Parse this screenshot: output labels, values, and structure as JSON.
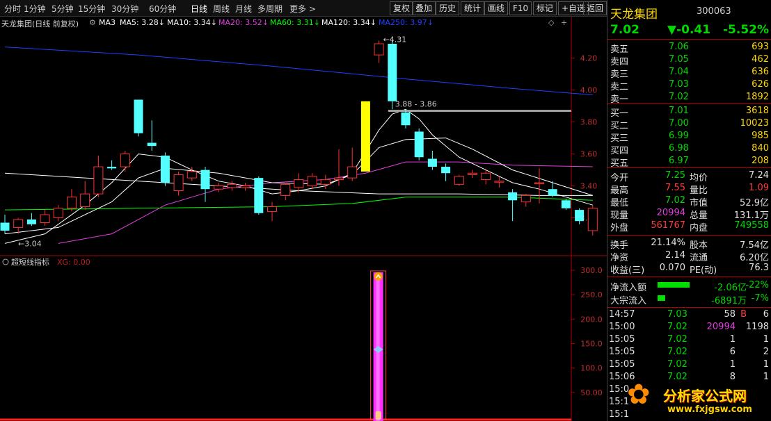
{
  "toolbar": {
    "periods": [
      "分时",
      "1分钟",
      "5分钟",
      "15分钟",
      "30分钟",
      "60分钟",
      "日线",
      "周线",
      "月线",
      "多周期",
      "更多 >"
    ],
    "buttons": [
      "复权",
      "叠加",
      "历史",
      "统计",
      "画线",
      "F10",
      "标记",
      "+自选",
      "返回"
    ]
  },
  "kline": {
    "title": "天龙集团(日线 前复权)",
    "ma": [
      {
        "label": "MA3",
        "color": "#ffffff"
      },
      {
        "label": "MA5: 3.28↓",
        "color": "#ffffff"
      },
      {
        "label": "MA10: 3.34↓",
        "color": "#ffffff"
      },
      {
        "label": "MA20: 3.52↓",
        "color": "#e040e0"
      },
      {
        "label": "MA60: 3.31↓",
        "color": "#00ff00"
      },
      {
        "label": "MA120: 3.34↓",
        "color": "#ffffff"
      },
      {
        "label": "MA250: 3.97↓",
        "color": "#2040ff"
      }
    ],
    "high_label": "4.31",
    "low_label": "3.04",
    "level_label": "3.88 - 3.86",
    "y_ticks": [
      "4.20",
      "4.00",
      "3.80",
      "3.60",
      "3.40",
      "3.20"
    ]
  },
  "indicator": {
    "title": "超短线指标",
    "xg_label": "XG: 0.00",
    "y_ticks": [
      "300.0",
      "250.0",
      "200.0",
      "150.0",
      "100.0",
      "50.00"
    ]
  },
  "chart_data": {
    "type": "candlestick",
    "ylim": [
      3.02,
      4.39
    ],
    "candles": [
      {
        "o": 3.17,
        "c": 3.12,
        "h": 3.22,
        "l": 3.1
      },
      {
        "o": 3.14,
        "c": 3.19,
        "h": 3.2,
        "l": 3.1
      },
      {
        "o": 3.19,
        "c": 3.16,
        "h": 3.23,
        "l": 3.15
      },
      {
        "o": 3.17,
        "c": 3.22,
        "h": 3.25,
        "l": 3.15
      },
      {
        "o": 3.2,
        "c": 3.26,
        "h": 3.28,
        "l": 3.18
      },
      {
        "o": 3.26,
        "c": 3.33,
        "h": 3.38,
        "l": 3.24
      },
      {
        "o": 3.27,
        "c": 3.35,
        "h": 3.43,
        "l": 3.25
      },
      {
        "o": 3.35,
        "c": 3.52,
        "h": 3.59,
        "l": 3.33
      },
      {
        "o": 3.52,
        "c": 3.51,
        "h": 3.56,
        "l": 3.5
      },
      {
        "o": 3.52,
        "c": 3.6,
        "h": 3.62,
        "l": 3.49
      },
      {
        "o": 3.94,
        "c": 3.73,
        "h": 3.94,
        "l": 3.71
      },
      {
        "o": 3.67,
        "c": 3.65,
        "h": 3.81,
        "l": 3.62
      },
      {
        "o": 3.59,
        "c": 3.42,
        "h": 3.61,
        "l": 3.4
      },
      {
        "o": 3.37,
        "c": 3.47,
        "h": 3.49,
        "l": 3.34
      },
      {
        "o": 3.45,
        "c": 3.49,
        "h": 3.52,
        "l": 3.43
      },
      {
        "o": 3.5,
        "c": 3.38,
        "h": 3.52,
        "l": 3.3
      },
      {
        "o": 3.38,
        "c": 3.4,
        "h": 3.42,
        "l": 3.36
      },
      {
        "o": 3.39,
        "c": 3.41,
        "h": 3.43,
        "l": 3.37
      },
      {
        "o": 3.39,
        "c": 3.4,
        "h": 3.42,
        "l": 3.37
      },
      {
        "o": 3.45,
        "c": 3.23,
        "h": 3.46,
        "l": 3.22
      },
      {
        "o": 3.24,
        "c": 3.27,
        "h": 3.3,
        "l": 3.18
      },
      {
        "o": 3.34,
        "c": 3.41,
        "h": 3.42,
        "l": 3.31
      },
      {
        "o": 3.39,
        "c": 3.44,
        "h": 3.48,
        "l": 3.36
      },
      {
        "o": 3.4,
        "c": 3.46,
        "h": 3.48,
        "l": 3.38
      },
      {
        "o": 3.41,
        "c": 3.44,
        "h": 3.47,
        "l": 3.38
      },
      {
        "o": 3.44,
        "c": 3.45,
        "h": 3.63,
        "l": 3.4
      },
      {
        "o": 3.45,
        "c": 3.52,
        "h": 3.64,
        "l": 3.43
      },
      {
        "o": 3.49,
        "c": 3.93,
        "h": 3.93,
        "l": 3.49
      },
      {
        "o": 4.22,
        "c": 4.29,
        "h": 4.31,
        "l": 4.17
      },
      {
        "o": 4.29,
        "c": 3.93,
        "h": 4.31,
        "l": 3.88
      },
      {
        "o": 3.86,
        "c": 3.78,
        "h": 3.88,
        "l": 3.76
      },
      {
        "o": 3.74,
        "c": 3.58,
        "h": 3.76,
        "l": 3.56
      },
      {
        "o": 3.57,
        "c": 3.52,
        "h": 3.62,
        "l": 3.5
      },
      {
        "o": 3.52,
        "c": 3.48,
        "h": 3.54,
        "l": 3.43
      },
      {
        "o": 3.41,
        "c": 3.46,
        "h": 3.47,
        "l": 3.4
      },
      {
        "o": 3.47,
        "c": 3.48,
        "h": 3.5,
        "l": 3.45
      },
      {
        "o": 3.44,
        "c": 3.48,
        "h": 3.5,
        "l": 3.41
      },
      {
        "o": 3.43,
        "c": 3.43,
        "h": 3.46,
        "l": 3.39
      },
      {
        "o": 3.36,
        "c": 3.31,
        "h": 3.38,
        "l": 3.18
      },
      {
        "o": 3.3,
        "c": 3.34,
        "h": 3.35,
        "l": 3.27
      },
      {
        "o": 3.42,
        "c": 3.42,
        "h": 3.51,
        "l": 3.29
      },
      {
        "o": 3.38,
        "c": 3.34,
        "h": 3.43,
        "l": 3.33
      },
      {
        "o": 3.31,
        "c": 3.26,
        "h": 3.32,
        "l": 3.25
      },
      {
        "o": 3.25,
        "c": 3.18,
        "h": 3.26,
        "l": 3.16
      },
      {
        "o": 3.12,
        "c": 3.26,
        "h": 3.28,
        "l": 3.09
      }
    ],
    "ma_lines": [
      {
        "name": "MA250",
        "color": "#2040ff",
        "values": [
          [
            0,
            4.27
          ],
          [
            10,
            4.22
          ],
          [
            20,
            4.15
          ],
          [
            30,
            4.07
          ],
          [
            38,
            4.01
          ],
          [
            44,
            3.97
          ]
        ]
      },
      {
        "name": "MA60",
        "color": "#00ff00",
        "values": [
          [
            0,
            3.25
          ],
          [
            10,
            3.26
          ],
          [
            20,
            3.27
          ],
          [
            26,
            3.29
          ],
          [
            30,
            3.33
          ],
          [
            38,
            3.33
          ],
          [
            44,
            3.31
          ]
        ]
      },
      {
        "name": "MA120",
        "color": "#ffffff",
        "values": [
          [
            0,
            3.48
          ],
          [
            8,
            3.44
          ],
          [
            16,
            3.4
          ],
          [
            22,
            3.37
          ],
          [
            28,
            3.35
          ],
          [
            34,
            3.35
          ],
          [
            40,
            3.34
          ],
          [
            44,
            3.34
          ]
        ]
      },
      {
        "name": "MA20",
        "color": "#e040e0",
        "values": [
          [
            4,
            3.04
          ],
          [
            8,
            3.1
          ],
          [
            12,
            3.28
          ],
          [
            16,
            3.38
          ],
          [
            20,
            3.42
          ],
          [
            24,
            3.44
          ],
          [
            27,
            3.48
          ],
          [
            30,
            3.55
          ],
          [
            34,
            3.55
          ],
          [
            38,
            3.53
          ],
          [
            44,
            3.52
          ]
        ]
      },
      {
        "name": "MA10",
        "color": "#ffffff",
        "values": [
          [
            0,
            3.1
          ],
          [
            4,
            3.14
          ],
          [
            8,
            3.3
          ],
          [
            10,
            3.45
          ],
          [
            12,
            3.51
          ],
          [
            16,
            3.48
          ],
          [
            20,
            3.42
          ],
          [
            24,
            3.41
          ],
          [
            26,
            3.47
          ],
          [
            28,
            3.64
          ],
          [
            30,
            3.69
          ],
          [
            33,
            3.7
          ],
          [
            35,
            3.63
          ],
          [
            38,
            3.5
          ],
          [
            41,
            3.42
          ],
          [
            44,
            3.34
          ]
        ]
      },
      {
        "name": "MA5",
        "color": "#ffffff",
        "values": [
          [
            0,
            3.04
          ],
          [
            3,
            3.1
          ],
          [
            6,
            3.28
          ],
          [
            8,
            3.42
          ],
          [
            10,
            3.6
          ],
          [
            12,
            3.58
          ],
          [
            14,
            3.5
          ],
          [
            16,
            3.43
          ],
          [
            18,
            3.4
          ],
          [
            20,
            3.35
          ],
          [
            22,
            3.37
          ],
          [
            24,
            3.4
          ],
          [
            26,
            3.48
          ],
          [
            28,
            3.75
          ],
          [
            29,
            3.85
          ],
          [
            30,
            3.88
          ],
          [
            31,
            3.82
          ],
          [
            32,
            3.72
          ],
          [
            34,
            3.58
          ],
          [
            36,
            3.5
          ],
          [
            38,
            3.42
          ],
          [
            40,
            3.38
          ],
          [
            42,
            3.33
          ],
          [
            44,
            3.28
          ]
        ]
      }
    ],
    "resistance": {
      "from": 29,
      "value": 3.87
    },
    "indicator": {
      "type": "bar",
      "ylim": [
        0,
        330
      ],
      "bar_index": 28,
      "value": 296,
      "marker_value": 138
    }
  },
  "quote": {
    "name": "天龙集团",
    "code": "300063",
    "price": "7.02",
    "change": "▼-0.41",
    "pct": "-5.52%",
    "asks": [
      {
        "label": "卖五",
        "price": "7.06",
        "vol": "693"
      },
      {
        "label": "卖四",
        "price": "7.05",
        "vol": "462"
      },
      {
        "label": "卖三",
        "price": "7.04",
        "vol": "636"
      },
      {
        "label": "卖二",
        "price": "7.03",
        "vol": "626"
      },
      {
        "label": "卖一",
        "price": "7.02",
        "vol": "1892"
      }
    ],
    "bids": [
      {
        "label": "买一",
        "price": "7.01",
        "vol": "3618"
      },
      {
        "label": "买二",
        "price": "7.00",
        "vol": "10023"
      },
      {
        "label": "买三",
        "price": "6.99",
        "vol": "985"
      },
      {
        "label": "买四",
        "price": "6.98",
        "vol": "840"
      },
      {
        "label": "买五",
        "price": "6.97",
        "vol": "208"
      }
    ],
    "stats": [
      {
        "l1": "今开",
        "v1": "7.25",
        "c1": "g",
        "l2": "均价",
        "v2": "7.24",
        "c2": "w"
      },
      {
        "l1": "最高",
        "v1": "7.55",
        "c1": "r",
        "l2": "量比",
        "v2": "1.09",
        "c2": "r"
      },
      {
        "l1": "最低",
        "v1": "7.02",
        "c1": "g",
        "l2": "市值",
        "v2": "52.9亿",
        "c2": "w"
      },
      {
        "l1": "现量",
        "v1": "20994",
        "c1": "m",
        "l2": "总量",
        "v2": "131.1万",
        "c2": "w"
      },
      {
        "l1": "外盘",
        "v1": "561767",
        "c1": "r",
        "l2": "内盘",
        "v2": "749558",
        "c2": "g"
      }
    ],
    "fin": [
      {
        "l1": "换手",
        "v1": "21.14%",
        "l2": "股本",
        "v2": "7.54亿"
      },
      {
        "l1": "净资",
        "v1": "2.14",
        "l2": "流通",
        "v2": "6.20亿"
      },
      {
        "l1": "收益(三)",
        "v1": "0.070",
        "l2": "PE(动)",
        "v2": "76.3"
      }
    ],
    "flow": [
      {
        "label": "净流入额",
        "amount": "-2.06亿",
        "pct": "-22%",
        "bar": 0.85
      },
      {
        "label": "大宗流入",
        "amount": "-6891万",
        "pct": "-7%",
        "bar": 0.2
      }
    ],
    "ticks": [
      {
        "time": "14:57",
        "price": "7.03",
        "vol": "58",
        "vc": "w",
        "flag": "B",
        "n": "6"
      },
      {
        "time": "15:00",
        "price": "7.02",
        "vol": "20994",
        "vc": "m",
        "flag": "",
        "n": "1198"
      },
      {
        "time": "15:05",
        "price": "7.02",
        "vol": "1",
        "vc": "w",
        "flag": "",
        "n": "1"
      },
      {
        "time": "15:05",
        "price": "7.02",
        "vol": "6",
        "vc": "w",
        "flag": "",
        "n": "2"
      },
      {
        "time": "15:05",
        "price": "7.02",
        "vol": "1",
        "vc": "w",
        "flag": "",
        "n": "1"
      },
      {
        "time": "15:06",
        "price": "7.02",
        "vol": "8",
        "vc": "w",
        "flag": "",
        "n": "1"
      },
      {
        "time": "15:0",
        "price": "",
        "vol": "",
        "vc": "w",
        "flag": "",
        "n": ""
      },
      {
        "time": "15:1",
        "price": "",
        "vol": "",
        "vc": "w",
        "flag": "",
        "n": ""
      },
      {
        "time": "15:1",
        "price": "",
        "vol": "",
        "vc": "w",
        "flag": "",
        "n": ""
      }
    ],
    "watermark": {
      "name": "分析家公式网",
      "url": "www.fxjgsw.com"
    }
  }
}
